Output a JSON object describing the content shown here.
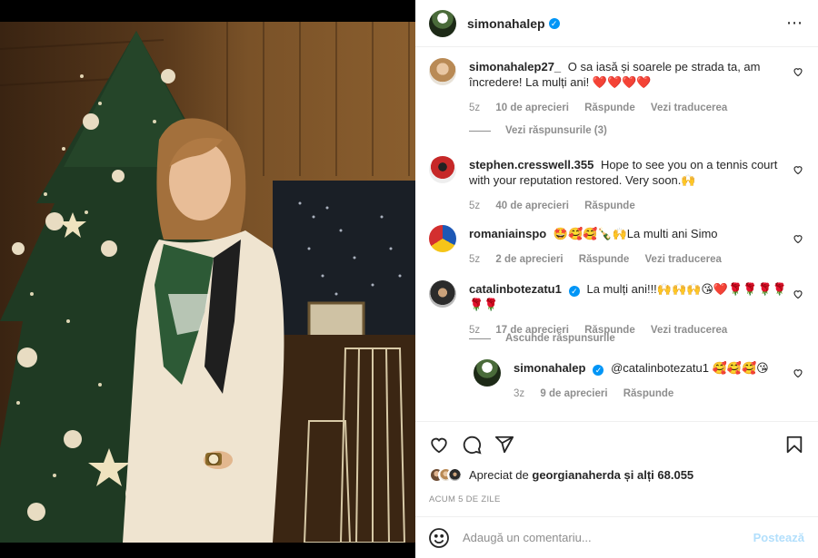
{
  "header": {
    "username": "simonahalep",
    "verified_mark": "✓",
    "more_icon": "⋯"
  },
  "comments": [
    {
      "username": "simonahalep27_",
      "text": "O sa iasă și soarele pe strada ta, am încredere! La mulți ani! ❤️❤️❤️❤️",
      "age": "5z",
      "likes": "10 de aprecieri",
      "reply": "Răspunde",
      "translate": "Vezi traducerea",
      "view_replies": "Vezi răspunsurile (3)"
    },
    {
      "username": "stephen.cresswell.355",
      "text": "Hope to see you on a tennis court with your reputation restored. Very soon.🙌",
      "age": "5z",
      "likes": "40 de aprecieri",
      "reply": "Răspunde"
    },
    {
      "username": "romaniainspo",
      "text": "🤩🥰🥰🍾🙌La multi ani Simo",
      "age": "5z",
      "likes": "2 de aprecieri",
      "reply": "Răspunde",
      "translate": "Vezi traducerea"
    },
    {
      "username": "catalinbotezatu1",
      "text": "La mulți ani!!!🙌🙌🙌😘❤️🌹🌹🌹🌹🌹🌹",
      "age": "5z",
      "likes": "17 de aprecieri",
      "reply": "Răspunde",
      "translate": "Vezi traducerea",
      "hide_replies": "Ascunde răspunsurile"
    }
  ],
  "reply": {
    "username": "simonahalep",
    "text": "@catalinbotezatu1 🥰🥰🥰😘",
    "age": "3z",
    "likes": "9 de aprecieri",
    "reply": "Răspunde"
  },
  "likes": {
    "prefix": "Apreciat de",
    "user": "georgianaherda",
    "suffix": "și alți 68.055"
  },
  "timestamp": "ACUM 5 DE ZILE",
  "add_comment": {
    "placeholder": "Adaugă un comentariu...",
    "post_label": "Postează"
  },
  "colors": {
    "verified": "#0095f6",
    "muted": "#8e8e8e",
    "post_disabled": "#b2dffc"
  }
}
